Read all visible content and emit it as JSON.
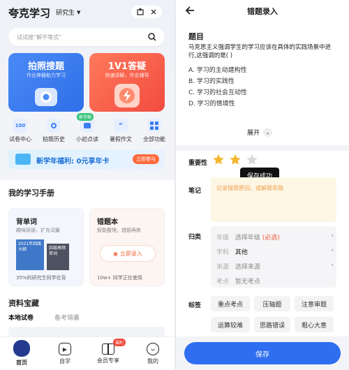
{
  "left": {
    "brand": "夸克学习",
    "grade": "研究生",
    "search_placeholder": "试试搜“解不等式”",
    "card_search": {
      "title": "拍照搜题",
      "sub": "作业神器助力学习"
    },
    "card_answer": {
      "title": "1V1答疑",
      "sub": "快速讲解，作业辅导"
    },
    "quick_actions": [
      {
        "label": "试卷中心",
        "icon": "paper-icon"
      },
      {
        "label": "拍题历史",
        "icon": "camera-history-icon"
      },
      {
        "label": "小初点读",
        "icon": "read-icon",
        "badge": "新学期"
      },
      {
        "label": "暑假作文",
        "icon": "essay-icon"
      },
      {
        "label": "全部功能",
        "icon": "grid-icon"
      }
    ],
    "banner": {
      "text": "新学年福利: 0元享年卡",
      "button": "立即参与"
    },
    "handbook_title": "我的学习手册",
    "book1": {
      "title": "背单词",
      "sub": "趣味阅读，扩充词量",
      "cover1": "2021年四级大纲",
      "cover2": "四级高频单词",
      "stat": "35%的研究生同学在背"
    },
    "book2": {
      "title": "错题本",
      "sub": "智能整理，错题再练",
      "button": "立即录入",
      "stat": "10w+ 同学正在使用"
    },
    "resources_title": "资料宝藏",
    "tabs": [
      "本地试卷",
      "备考锦囊"
    ],
    "nav": [
      {
        "label": "首页",
        "icon": "home-icon"
      },
      {
        "label": "自学",
        "icon": "play-icon"
      },
      {
        "label": "会员专享",
        "icon": "gift-icon",
        "badge": "福利"
      },
      {
        "label": "我的",
        "icon": "profile-icon"
      }
    ],
    "colors": {
      "blue": "#3b7df0",
      "red": "#f45a44"
    }
  },
  "right": {
    "title": "错题录入",
    "question_label": "题目",
    "question_text": "马克思主义强调学生的学习应该在具体的实践场景中进行,这强调的是( )",
    "options": [
      "A. 学习的主动建构性",
      "B. 学习的实践性",
      "C. 学习的社会互动性",
      "D. 学习的情境性"
    ],
    "expand": "展开",
    "importance_label": "重要性",
    "toast": "保存成功",
    "notes_label": "笔记",
    "notes_placeholder": "记录错题原因，或解题思路",
    "category_label": "归类",
    "categories": [
      {
        "key": "年级",
        "value": "选择年级",
        "extra": "(必选)"
      },
      {
        "key": "学科",
        "value": "其他",
        "extra": ""
      },
      {
        "key": "来源",
        "value": "选择来源",
        "extra": ""
      },
      {
        "key": "考点",
        "value": "暂无考点",
        "extra": ""
      }
    ],
    "tags_label": "标签",
    "tags": [
      "重点考点",
      "压轴题",
      "注意审题",
      "运算较难",
      "思路错误",
      "粗心大意"
    ],
    "save": "保存",
    "stars_filled": 2,
    "stars_total": 3,
    "colors": {
      "primary": "#2f6ef0",
      "star": "#f5b731",
      "required": "#f05a3a"
    }
  }
}
